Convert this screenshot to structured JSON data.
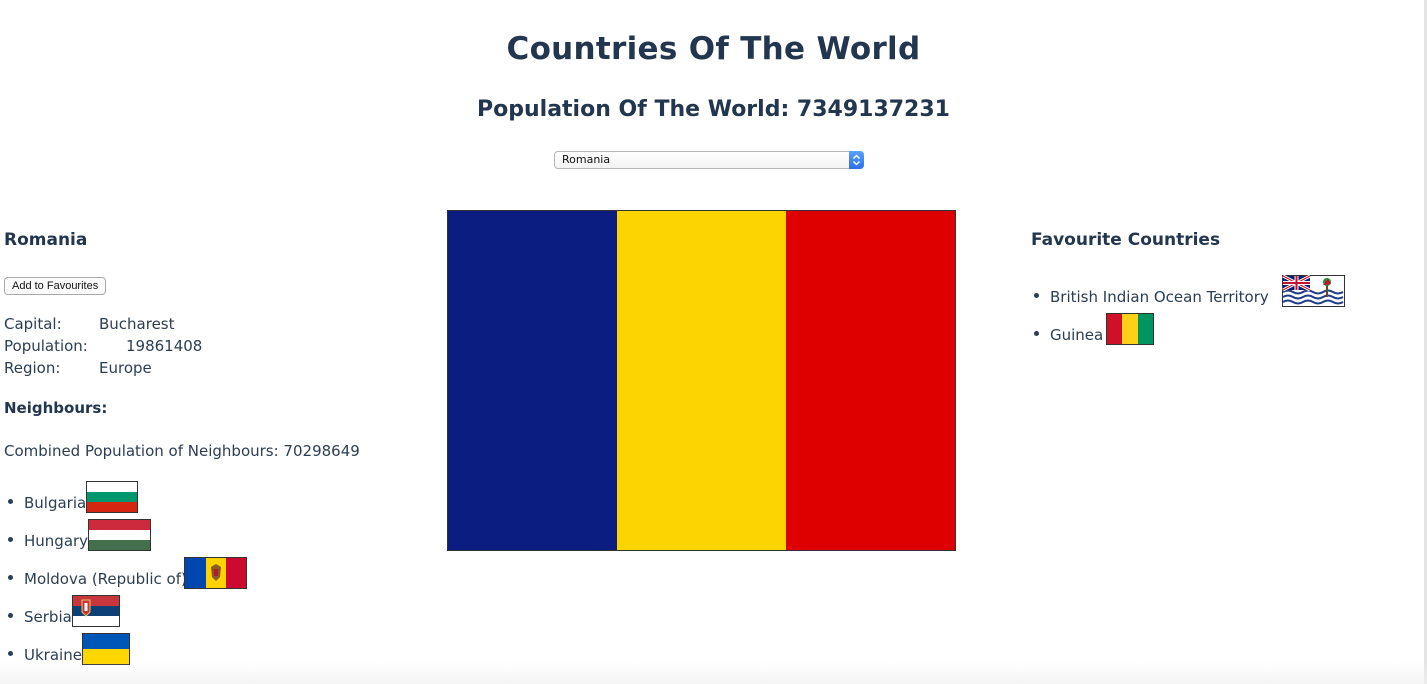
{
  "header": {
    "title": "Countries Of The World",
    "world_population_label": "Population Of The World: 7349137231"
  },
  "select": {
    "selected": "Romania"
  },
  "selected_country": {
    "name": "Romania",
    "add_button_label": "Add to Favourites",
    "capital_label": "Capital:",
    "capital": "Bucharest",
    "population_label": "Population:",
    "population": "19861408",
    "region_label": "Region:",
    "region": "Europe",
    "neighbours_title": "Neighbours:",
    "combined_population": "Combined Population of Neighbours: 70298649",
    "flag_colors": [
      "#0b1d80",
      "#fcd500",
      "#de0000"
    ]
  },
  "neighbours": [
    {
      "name": "Bulgaria",
      "flag": "bulgaria-flag"
    },
    {
      "name": "Hungary",
      "flag": "hungary-flag"
    },
    {
      "name": "Moldova (Republic of)",
      "flag": "moldova-flag"
    },
    {
      "name": "Serbia",
      "flag": "serbia-flag"
    },
    {
      "name": "Ukraine",
      "flag": "ukraine-flag"
    }
  ],
  "favourites": {
    "title": "Favourite Countries",
    "items": [
      {
        "name": "British Indian Ocean Territory",
        "flag": "biot-flag"
      },
      {
        "name": "Guinea",
        "flag": "guinea-flag"
      }
    ]
  }
}
